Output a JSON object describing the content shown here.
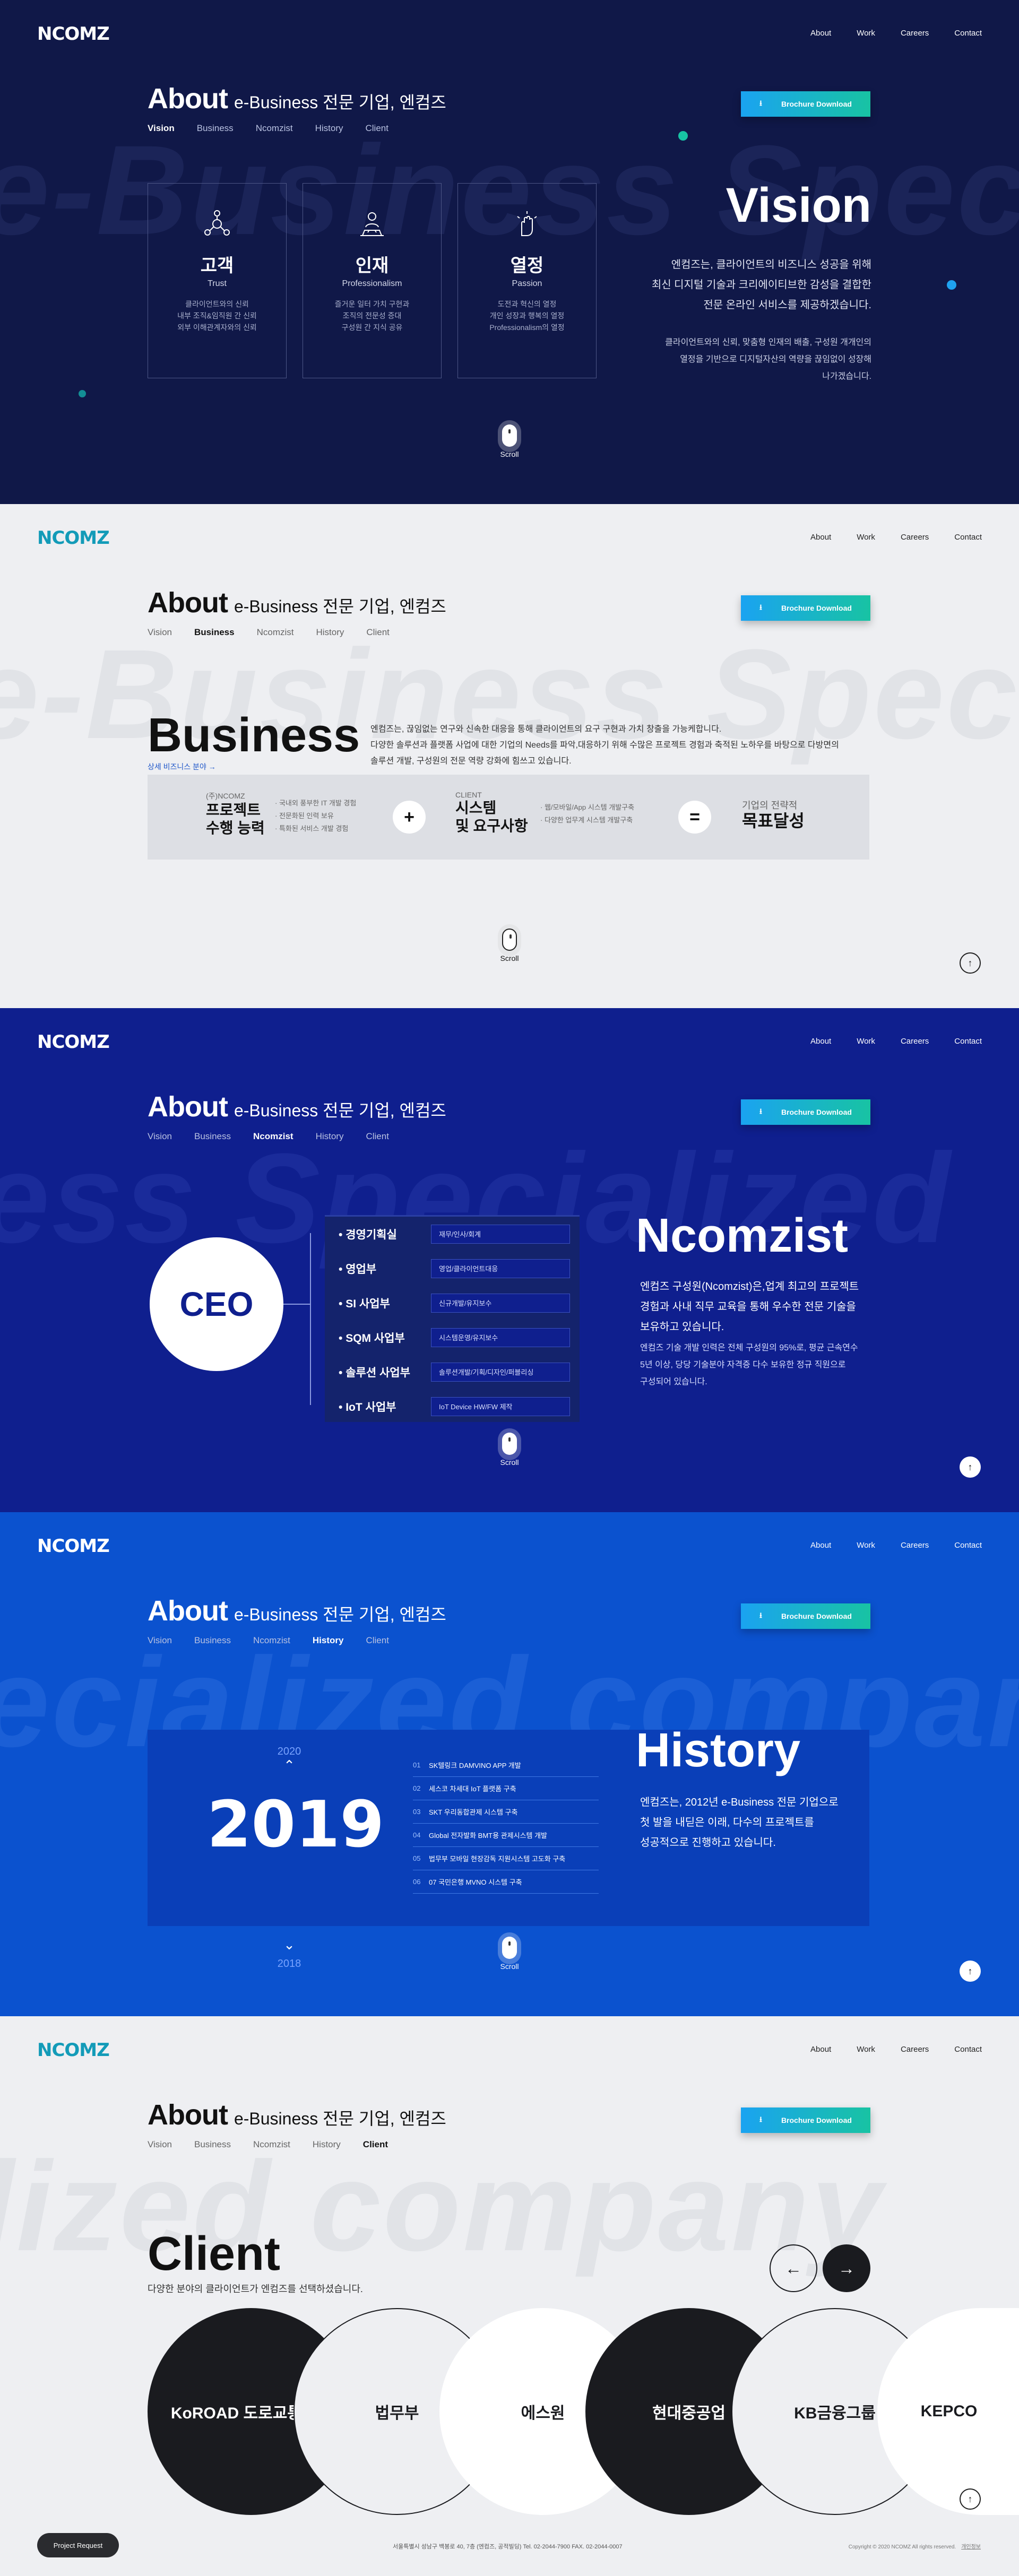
{
  "nav": {
    "logo": "NCOMZ",
    "menu": [
      "About",
      "Work",
      "Careers",
      "Contact"
    ]
  },
  "header": {
    "title": "About",
    "subtitle": "e-Business 전문 기업, 엔컴즈",
    "subnav": [
      "Vision",
      "Business",
      "Ncomzist",
      "History",
      "Client"
    ],
    "brochure": "Brochure Download"
  },
  "scroll_label": "Scroll",
  "vision": {
    "bg_text": "e-Business Specialized company",
    "title": "Vision",
    "cards": [
      {
        "icon": "hub-icon",
        "kr": "고객",
        "en": "Trust",
        "desc": "클라이언트와의 신뢰\n내부 조직&임직원 간 신뢰\n외부 이해관계자와의 신뢰"
      },
      {
        "icon": "people-icon",
        "kr": "인재",
        "en": "Professionalism",
        "desc": "즐거운 일터 가치 구현과\n조직의 전문성 증대\n구성원 간 지식 공유"
      },
      {
        "icon": "hand-icon",
        "kr": "열정",
        "en": "Passion",
        "desc": "도전과 혁신의 열정\n개인 성장과 행복의 열정\nProfessionalism의 열정"
      }
    ],
    "text1": "엔컴즈는, 클라이언트의 비즈니스 성공을 위해\n최신 디지털 기술과 크리에이티브한 감성을 결합한\n전문 온라인 서비스를 제공하겠습니다.",
    "text2": "클라이언트와의 신뢰, 맞춤형 인재의 배출, 구성원 개개인의\n열정을 기반으로 디지털자산의 역량을 끊임없이 성장해\n나가겠습니다.",
    "colors": {
      "bg": "#101848",
      "dot_teal": "#17c3a4",
      "dot_blue": "#1fa2f0"
    }
  },
  "business": {
    "title": "Business",
    "link": "상세 비즈니스 분야 →",
    "text": "엔컴즈는, 끊임없는 연구와 신속한 대응을 통해 클라이언트의 요구 구현과 가치 창출을 가능케합니다.\n다양한 솔루션과 플랫폼 사업에 대한 기업의 Needs를 파악,대응하기 위해 수많은 프로젝트 경험과 축적된 노하우를 바탕으로 다방면의\n솔루션 개발, 구성원의 전문 역량 강화에 힘쓰고 있습니다.",
    "box": {
      "a_small": "(주)NCOMZ",
      "a_big": "프로젝트\n수행 능력",
      "a_list": [
        "· 국내외 풍부한 IT 개발 경험",
        "· 전문화된 인력 보유",
        "· 특화된 서비스 개발 경험"
      ],
      "plus": "+",
      "b_small": "CLIENT",
      "b_big": "시스템\n및 요구사항",
      "b_list": [
        "· 웹/모바일/App 시스템 개발구축",
        "· 다양한 업무계 시스템 개발구축"
      ],
      "eq": "=",
      "c_small": "기업의 전략적",
      "c_big": "목표달성"
    }
  },
  "ncomzist": {
    "bg_text": "ess Specialized",
    "title": "Ncomzist",
    "ceo": "CEO",
    "rows": [
      {
        "dep": "경영기획실",
        "task": "재무/인사/회계"
      },
      {
        "dep": "영업부",
        "task": "영업/클라이언트대응"
      },
      {
        "dep": "SI 사업부",
        "task": "신규개발/유지보수"
      },
      {
        "dep": "SQM 사업부",
        "task": "시스템운영/유지보수"
      },
      {
        "dep": "솔루션 사업부",
        "task": "솔루션개발/기획/디자인/퍼블리싱"
      },
      {
        "dep": "IoT 사업부",
        "task": "IoT Device HW/FW 제작"
      }
    ],
    "text1": "엔컴즈 구성원(Ncomzist)은,업계 최고의 프로젝트\n경험과 사내 직무 교육을 통해 우수한 전문 기술을\n보유하고 있습니다.",
    "text2": "엔컴즈 기술 개발 인력은 전체 구성원의 95%로, 평균 근속연수\n5년 이상, 당당 기술분야 자격증 다수 보유한 정규 직원으로\n구성되어 있습니다."
  },
  "history": {
    "bg_text": "ecialized company",
    "title": "History",
    "prev": "2020",
    "current": "2019",
    "next": "2018",
    "items": [
      {
        "n": "01",
        "t": "SK텔링크 DAMVINO APP 개발"
      },
      {
        "n": "02",
        "t": "세스코 차세대 IoT 플랫폼 구축"
      },
      {
        "n": "03",
        "t": "SKT 우리동합관제 시스템 구축"
      },
      {
        "n": "04",
        "t": "Global 전자발화 BMT용 관제시스템 개발"
      },
      {
        "n": "05",
        "t": "법무부 모바일 현장감독 지원시스템 고도화 구축"
      },
      {
        "n": "06",
        "t": "07 국민은행 MVNO 시스템 구축"
      }
    ],
    "text": "엔컴즈는, 2012년 e-Business 전문 기업으로\n첫 발을 내딛은 이래, 다수의 프로젝트를\n성공적으로 진행하고 있습니다."
  },
  "client": {
    "bg_text": "lized company",
    "title": "Client",
    "text": "다양한 분야의 클라이언트가 엔컴즈를 선택하셨습니다.",
    "prev": "←",
    "next": "→",
    "logos": [
      "KoROAD 도로교통공단",
      "법무부",
      "에스원",
      "현대중공업",
      "KB금융그룹",
      "KEPCO"
    ]
  },
  "footer": {
    "request": "Project Request",
    "address": "서울특별시 성남구 백봉로 40, 7층 (엔컴즈, 공적빌딩)   Tel. 02-2044-7900   FAX. 02-2044-0007",
    "copyright": "Copyright © 2020 NCOMZ All rights reserved.",
    "privacy": "개인정보"
  }
}
